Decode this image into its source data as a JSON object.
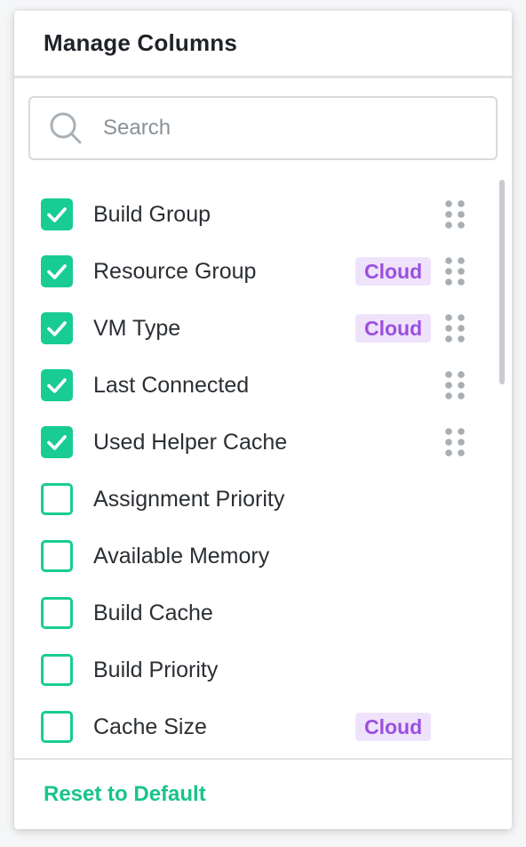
{
  "header": {
    "title": "Manage Columns"
  },
  "search": {
    "placeholder": "Search",
    "value": ""
  },
  "columns": [
    {
      "label": "Build Group",
      "checked": true,
      "badge": "",
      "draggable": true
    },
    {
      "label": "Resource Group",
      "checked": true,
      "badge": "Cloud",
      "draggable": true
    },
    {
      "label": "VM Type",
      "checked": true,
      "badge": "Cloud",
      "draggable": true
    },
    {
      "label": "Last Connected",
      "checked": true,
      "badge": "",
      "draggable": true
    },
    {
      "label": "Used Helper Cache",
      "checked": true,
      "badge": "",
      "draggable": true
    },
    {
      "label": "Assignment Priority",
      "checked": false,
      "badge": "",
      "draggable": false
    },
    {
      "label": "Available Memory",
      "checked": false,
      "badge": "",
      "draggable": false
    },
    {
      "label": "Build Cache",
      "checked": false,
      "badge": "",
      "draggable": false
    },
    {
      "label": "Build Priority",
      "checked": false,
      "badge": "",
      "draggable": false
    },
    {
      "label": "Cache Size",
      "checked": false,
      "badge": "Cloud",
      "draggable": false
    }
  ],
  "footer": {
    "reset_label": "Reset to Default"
  },
  "colors": {
    "accent": "#18cc93",
    "badge_bg": "#efe3fb",
    "badge_text": "#9b4fe0"
  },
  "icons": {
    "search": "search-icon",
    "checkmark": "checkmark-icon",
    "drag": "drag-handle-icon"
  }
}
